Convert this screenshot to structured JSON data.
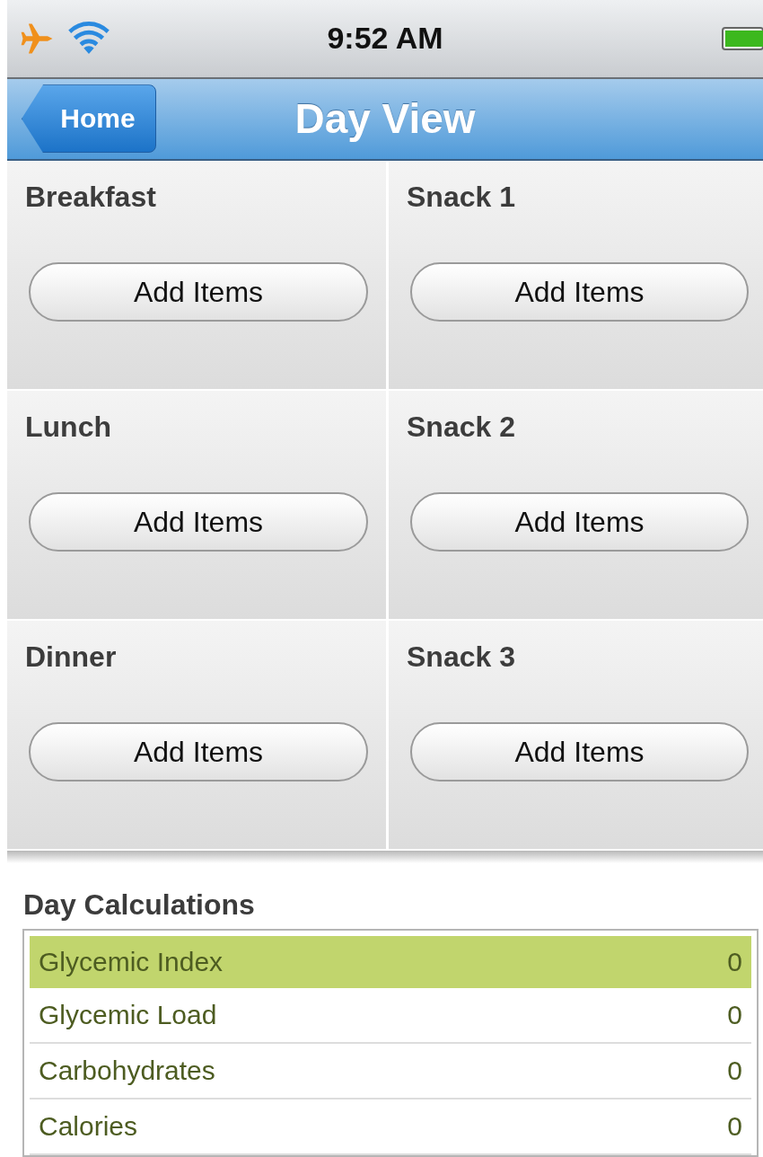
{
  "status_bar": {
    "time": "9:52 AM"
  },
  "nav_bar": {
    "back_button": "Home",
    "title": "Day View"
  },
  "meals": [
    {
      "name": "Breakfast",
      "button": "Add Items"
    },
    {
      "name": "Snack 1",
      "button": "Add Items"
    },
    {
      "name": "Lunch",
      "button": "Add Items"
    },
    {
      "name": "Snack 2",
      "button": "Add Items"
    },
    {
      "name": "Dinner",
      "button": "Add Items"
    },
    {
      "name": "Snack 3",
      "button": "Add Items"
    }
  ],
  "calculations": {
    "title": "Day Calculations",
    "rows": [
      {
        "label": "Glycemic Index",
        "value": "0",
        "selected": true
      },
      {
        "label": "Glycemic Load",
        "value": "0",
        "selected": false
      },
      {
        "label": "Carbohydrates",
        "value": "0",
        "selected": false
      },
      {
        "label": "Calories",
        "value": "0",
        "selected": false
      }
    ]
  }
}
